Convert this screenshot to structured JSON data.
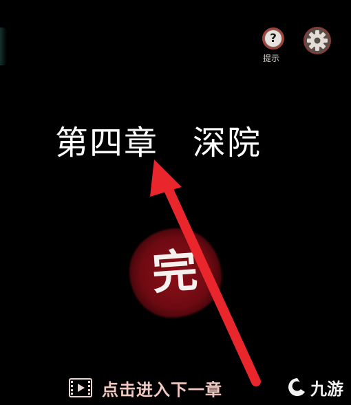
{
  "hud": {
    "hint_label": "提示",
    "hint_icon": "question-icon",
    "settings_icon": "gear-icon"
  },
  "chapter": {
    "title": "第四章　深院"
  },
  "seal": {
    "text": "完",
    "color": "#7d0c14"
  },
  "annotation": {
    "arrow_color": "#e8262c"
  },
  "footer": {
    "next_label": "点击进入下一章",
    "next_icon": "film-play-icon"
  },
  "watermark": {
    "text": "九游"
  }
}
